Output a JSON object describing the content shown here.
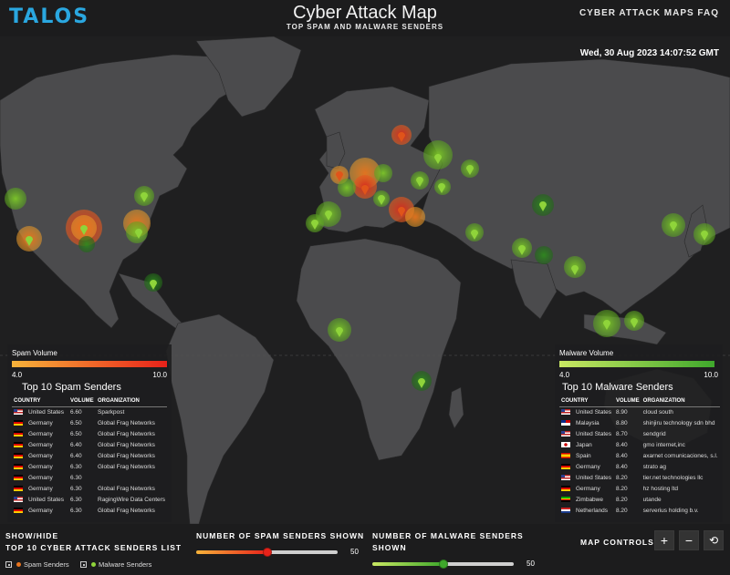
{
  "header": {
    "logo": "TALOS",
    "title": "Cyber Attack Map",
    "subtitle": "TOP SPAM AND MALWARE SENDERS",
    "faq_link": "CYBER ATTACK MAPS FAQ"
  },
  "timestamp": "Wed, 30 Aug 2023 14:07:52 GMT",
  "colors": {
    "spam": "#e8221a",
    "spam_light": "#f7b33a",
    "malware": "#3fa82c",
    "malware_light": "#c9e862",
    "accent": "#2aa7e0"
  },
  "spam_panel": {
    "legend_title": "Spam Volume",
    "legend_min": "4.0",
    "legend_max": "10.0",
    "list_title": "Top 10 Spam Senders",
    "columns": [
      "COUNTRY",
      "VOLUME",
      "ORGANIZATION"
    ],
    "rows": [
      {
        "flag": "us",
        "country": "United States",
        "volume": "6.60",
        "org": "Sparkpost"
      },
      {
        "flag": "de",
        "country": "Germany",
        "volume": "6.50",
        "org": "Global Frag Networks"
      },
      {
        "flag": "de",
        "country": "Germany",
        "volume": "6.50",
        "org": "Global Frag Networks"
      },
      {
        "flag": "de",
        "country": "Germany",
        "volume": "6.40",
        "org": "Global Frag Networks"
      },
      {
        "flag": "de",
        "country": "Germany",
        "volume": "6.40",
        "org": "Global Frag Networks"
      },
      {
        "flag": "de",
        "country": "Germany",
        "volume": "6.30",
        "org": "Global Frag Networks"
      },
      {
        "flag": "de",
        "country": "Germany",
        "volume": "6.30",
        "org": ""
      },
      {
        "flag": "de",
        "country": "Germany",
        "volume": "6.30",
        "org": "Global Frag Networks"
      },
      {
        "flag": "us",
        "country": "United States",
        "volume": "6.30",
        "org": "RagingWire Data Centers"
      },
      {
        "flag": "de",
        "country": "Germany",
        "volume": "6.30",
        "org": "Global Frag Networks"
      }
    ]
  },
  "malware_panel": {
    "legend_title": "Malware Volume",
    "legend_min": "4.0",
    "legend_max": "10.0",
    "list_title": "Top 10 Malware Senders",
    "columns": [
      "COUNTRY",
      "VOLUME",
      "ORGANIZATION"
    ],
    "rows": [
      {
        "flag": "us",
        "country": "United States",
        "volume": "8.90",
        "org": "cloud south"
      },
      {
        "flag": "my",
        "country": "Malaysia",
        "volume": "8.80",
        "org": "shinjiru technology sdn bhd"
      },
      {
        "flag": "us",
        "country": "United States",
        "volume": "8.70",
        "org": "sendgrid"
      },
      {
        "flag": "jp",
        "country": "Japan",
        "volume": "8.40",
        "org": "gmo internet,inc"
      },
      {
        "flag": "es",
        "country": "Spain",
        "volume": "8.40",
        "org": "axarnet comunicaciones, s.l."
      },
      {
        "flag": "de",
        "country": "Germany",
        "volume": "8.40",
        "org": "strato ag"
      },
      {
        "flag": "us",
        "country": "United States",
        "volume": "8.20",
        "org": "tier.net technologies llc"
      },
      {
        "flag": "de",
        "country": "Germany",
        "volume": "8.20",
        "org": "hz hosting ltd"
      },
      {
        "flag": "zw",
        "country": "Zimbabwe",
        "volume": "8.20",
        "org": "utande"
      },
      {
        "flag": "nl",
        "country": "Netherlands",
        "volume": "8.20",
        "org": "serverius holding b.v."
      }
    ]
  },
  "footer": {
    "show_hide_line1": "SHOW/HIDE",
    "show_hide_line2": "TOP 10 CYBER ATTACK SENDERS LIST",
    "spam_toggle": "Spam Senders",
    "malware_toggle": "Malware Senders",
    "spam_slider_label": "NUMBER OF SPAM SENDERS SHOWN",
    "spam_slider_value": "50",
    "spam_slider_fraction": 0.5,
    "malware_slider_label_1": "NUMBER OF MALWARE SENDERS",
    "malware_slider_label_2": "SHOWN",
    "malware_slider_value": "50",
    "malware_slider_fraction": 0.5,
    "map_controls": "MAP CONTROLS",
    "zoom_in": "+",
    "zoom_out": "−",
    "reset": "⟲"
  }
}
